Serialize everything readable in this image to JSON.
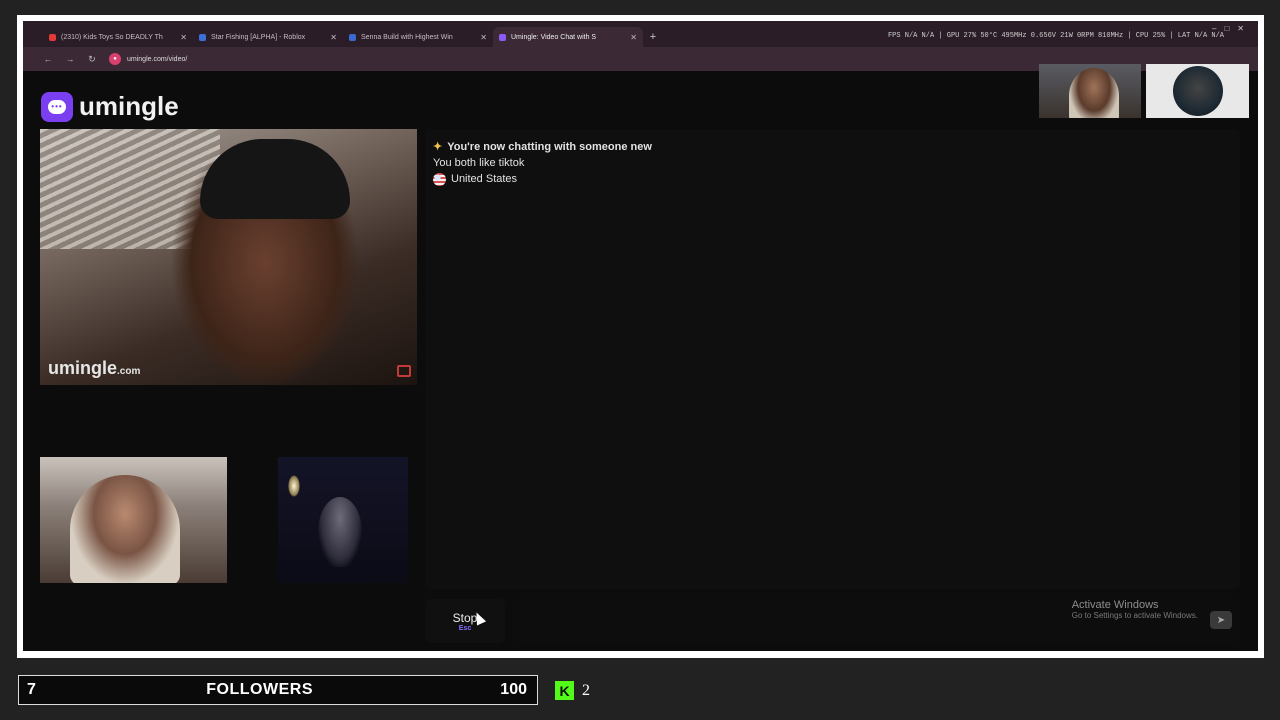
{
  "browser": {
    "tabs": [
      {
        "label": "(2310) Kids Toys So DEADLY Th",
        "fav_color": "#e53935"
      },
      {
        "label": "Star Fishing [ALPHA] - Roblox",
        "fav_color": "#3d6fd8"
      },
      {
        "label": "Senna Build with Highest Win",
        "fav_color": "#3a6ad1"
      },
      {
        "label": "Umingle: Video Chat with S",
        "fav_color": "#8a5cf5"
      }
    ],
    "new_tab": "+",
    "url": "umingle.com/video/",
    "stats": "FPS N/A N/A | GPU 27% 50°C 495MHz 0.656V 21W 0RPM 810MHz | CPU 25% | LAT N/A N/A"
  },
  "page": {
    "logo_text": "umingle",
    "watermark": "umingle",
    "watermark_suffix": ".com",
    "chat": {
      "new_chat": "You're now chatting with someone new",
      "interest": "You both like tiktok",
      "country": "United States"
    },
    "stop_label": "Stop",
    "stop_key": "Esc",
    "activate_title": "Activate Windows",
    "activate_sub": "Go to Settings to activate Windows."
  },
  "stream": {
    "followers_current": "7",
    "followers_label": "FOLLOWERS",
    "followers_goal": "100",
    "kick_icon": "K",
    "kick_count": "2"
  }
}
